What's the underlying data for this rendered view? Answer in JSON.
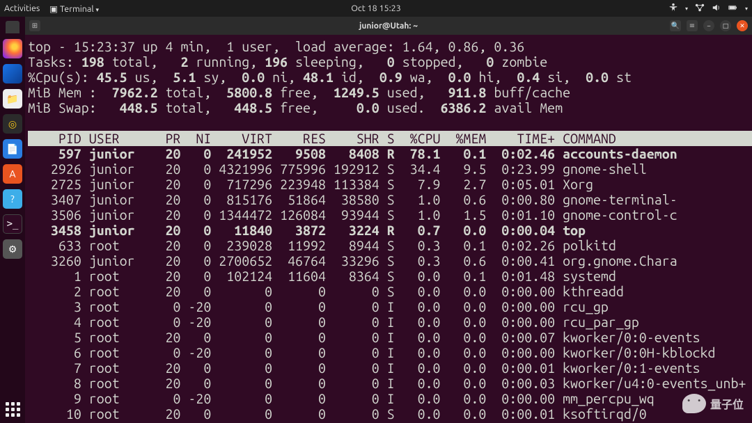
{
  "topbar": {
    "activities": "Activities",
    "app": "Terminal",
    "clock": "Oct 18  15:23"
  },
  "titlebar": {
    "title": "junior@Utah: ~"
  },
  "top": {
    "summary": {
      "time": "15:23:37",
      "uptime": "up 4 min",
      "users": "1 user",
      "loadavg": "1.64, 0.86, 0.36"
    },
    "tasks": {
      "total": 198,
      "running": 2,
      "sleeping": 196,
      "stopped": 0,
      "zombie": 0
    },
    "cpu": {
      "us": 45.5,
      "sy": 5.1,
      "ni": 0.0,
      "id": 48.1,
      "wa": 0.9,
      "hi": 0.0,
      "si": 0.4,
      "st": 0.0
    },
    "mem": {
      "unit": "MiB Mem :",
      "total": 7962.2,
      "free": 5800.8,
      "used": 1249.5,
      "buffcache": 911.8
    },
    "swap": {
      "unit": "MiB Swap:",
      "total": 448.5,
      "free": 448.5,
      "used": 0.0,
      "avail": 6386.2
    }
  },
  "columns": [
    "PID",
    "USER",
    "PR",
    "NI",
    "VIRT",
    "RES",
    "SHR",
    "S",
    "%CPU",
    "%MEM",
    "TIME+",
    "COMMAND"
  ],
  "processes": [
    {
      "pid": 597,
      "user": "junior",
      "pr": 20,
      "ni": 0,
      "virt": 241952,
      "res": 9508,
      "shr": 8408,
      "s": "R",
      "cpu": 78.1,
      "mem": 0.1,
      "time": "0:02.46",
      "cmd": "accounts-daemon",
      "bold": true
    },
    {
      "pid": 2926,
      "user": "junior",
      "pr": 20,
      "ni": 0,
      "virt": 4321996,
      "res": 775996,
      "shr": 192912,
      "s": "S",
      "cpu": 34.4,
      "mem": 9.5,
      "time": "0:23.99",
      "cmd": "gnome-shell"
    },
    {
      "pid": 2725,
      "user": "junior",
      "pr": 20,
      "ni": 0,
      "virt": 717296,
      "res": 223948,
      "shr": 113384,
      "s": "S",
      "cpu": 7.9,
      "mem": 2.7,
      "time": "0:05.01",
      "cmd": "Xorg"
    },
    {
      "pid": 3407,
      "user": "junior",
      "pr": 20,
      "ni": 0,
      "virt": 815176,
      "res": 51864,
      "shr": 38580,
      "s": "S",
      "cpu": 1.0,
      "mem": 0.6,
      "time": "0:00.80",
      "cmd": "gnome-terminal-"
    },
    {
      "pid": 3506,
      "user": "junior",
      "pr": 20,
      "ni": 0,
      "virt": 1344472,
      "res": 126084,
      "shr": 93944,
      "s": "S",
      "cpu": 1.0,
      "mem": 1.5,
      "time": "0:01.10",
      "cmd": "gnome-control-c"
    },
    {
      "pid": 3458,
      "user": "junior",
      "pr": 20,
      "ni": 0,
      "virt": 11840,
      "res": 3872,
      "shr": 3224,
      "s": "R",
      "cpu": 0.7,
      "mem": 0.0,
      "time": "0:00.04",
      "cmd": "top",
      "bold": true
    },
    {
      "pid": 633,
      "user": "root",
      "pr": 20,
      "ni": 0,
      "virt": 239028,
      "res": 11992,
      "shr": 8944,
      "s": "S",
      "cpu": 0.3,
      "mem": 0.1,
      "time": "0:02.26",
      "cmd": "polkitd"
    },
    {
      "pid": 3260,
      "user": "junior",
      "pr": 20,
      "ni": 0,
      "virt": 2700652,
      "res": 46764,
      "shr": 33296,
      "s": "S",
      "cpu": 0.3,
      "mem": 0.6,
      "time": "0:00.41",
      "cmd": "org.gnome.Chara"
    },
    {
      "pid": 1,
      "user": "root",
      "pr": 20,
      "ni": 0,
      "virt": 102124,
      "res": 11604,
      "shr": 8364,
      "s": "S",
      "cpu": 0.0,
      "mem": 0.1,
      "time": "0:01.48",
      "cmd": "systemd"
    },
    {
      "pid": 2,
      "user": "root",
      "pr": 20,
      "ni": 0,
      "virt": 0,
      "res": 0,
      "shr": 0,
      "s": "S",
      "cpu": 0.0,
      "mem": 0.0,
      "time": "0:00.00",
      "cmd": "kthreadd"
    },
    {
      "pid": 3,
      "user": "root",
      "pr": 0,
      "ni": -20,
      "virt": 0,
      "res": 0,
      "shr": 0,
      "s": "I",
      "cpu": 0.0,
      "mem": 0.0,
      "time": "0:00.00",
      "cmd": "rcu_gp"
    },
    {
      "pid": 4,
      "user": "root",
      "pr": 0,
      "ni": -20,
      "virt": 0,
      "res": 0,
      "shr": 0,
      "s": "I",
      "cpu": 0.0,
      "mem": 0.0,
      "time": "0:00.00",
      "cmd": "rcu_par_gp"
    },
    {
      "pid": 5,
      "user": "root",
      "pr": 20,
      "ni": 0,
      "virt": 0,
      "res": 0,
      "shr": 0,
      "s": "I",
      "cpu": 0.0,
      "mem": 0.0,
      "time": "0:00.07",
      "cmd": "kworker/0:0-events"
    },
    {
      "pid": 6,
      "user": "root",
      "pr": 0,
      "ni": -20,
      "virt": 0,
      "res": 0,
      "shr": 0,
      "s": "I",
      "cpu": 0.0,
      "mem": 0.0,
      "time": "0:00.00",
      "cmd": "kworker/0:0H-kblockd"
    },
    {
      "pid": 7,
      "user": "root",
      "pr": 20,
      "ni": 0,
      "virt": 0,
      "res": 0,
      "shr": 0,
      "s": "I",
      "cpu": 0.0,
      "mem": 0.0,
      "time": "0:00.01",
      "cmd": "kworker/0:1-events"
    },
    {
      "pid": 8,
      "user": "root",
      "pr": 20,
      "ni": 0,
      "virt": 0,
      "res": 0,
      "shr": 0,
      "s": "I",
      "cpu": 0.0,
      "mem": 0.0,
      "time": "0:00.03",
      "cmd": "kworker/u4:0-events_unb+"
    },
    {
      "pid": 9,
      "user": "root",
      "pr": 0,
      "ni": -20,
      "virt": 0,
      "res": 0,
      "shr": 0,
      "s": "I",
      "cpu": 0.0,
      "mem": 0.0,
      "time": "0:00.00",
      "cmd": "mm_percpu_wq"
    },
    {
      "pid": 10,
      "user": "root",
      "pr": 20,
      "ni": 0,
      "virt": 0,
      "res": 0,
      "shr": 0,
      "s": "S",
      "cpu": 0.0,
      "mem": 0.0,
      "time": "0:00.01",
      "cmd": "ksoftirqd/0"
    }
  ],
  "watermark": "量子位"
}
